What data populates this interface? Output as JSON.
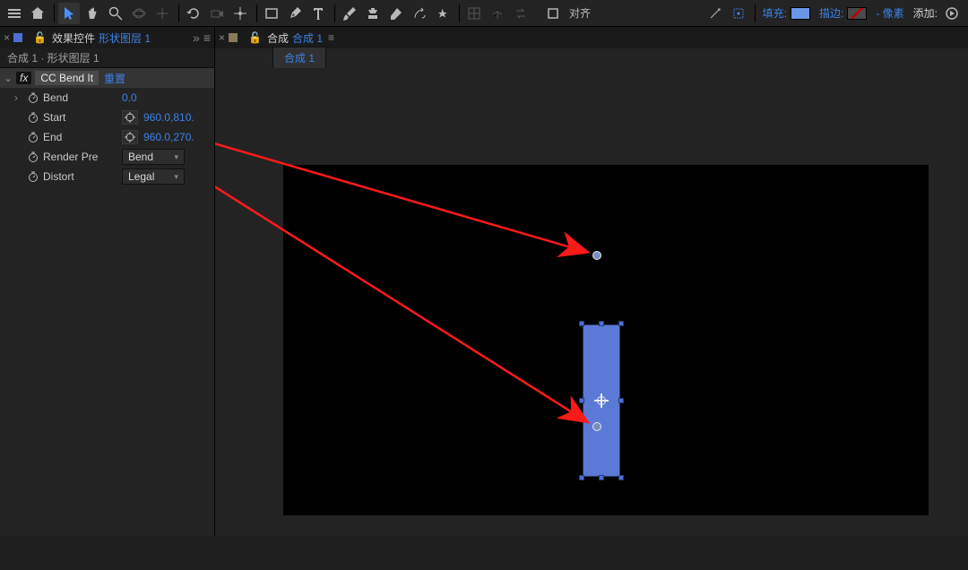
{
  "toolbar_right": {
    "align": "对齐",
    "fill_label": "填充:",
    "stroke_label": "描边:",
    "px_label": "- 像素",
    "add_label": "添加:"
  },
  "left_panel": {
    "tab_label": "效果控件",
    "tab_link": "形状图层 1",
    "breadcrumb": "合成 1 · 形状图层 1",
    "fx_icon": "fx",
    "effect_name": "CC Bend It",
    "reset": "重置",
    "props": {
      "bend": {
        "label": "Bend",
        "value": "0.0"
      },
      "start": {
        "label": "Start",
        "value": "960.0,810."
      },
      "end": {
        "label": "End",
        "value": "960.0,270."
      },
      "render": {
        "label": "Render Pre",
        "value": "Bend"
      },
      "distort": {
        "label": "Distort",
        "value": "Legal"
      }
    }
  },
  "right_panel": {
    "tab_label": "合成",
    "tab_link": "合成 1",
    "subtab": "合成 1"
  },
  "colors": {
    "accent": "#3d82e8",
    "shape": "#5b79d6"
  }
}
